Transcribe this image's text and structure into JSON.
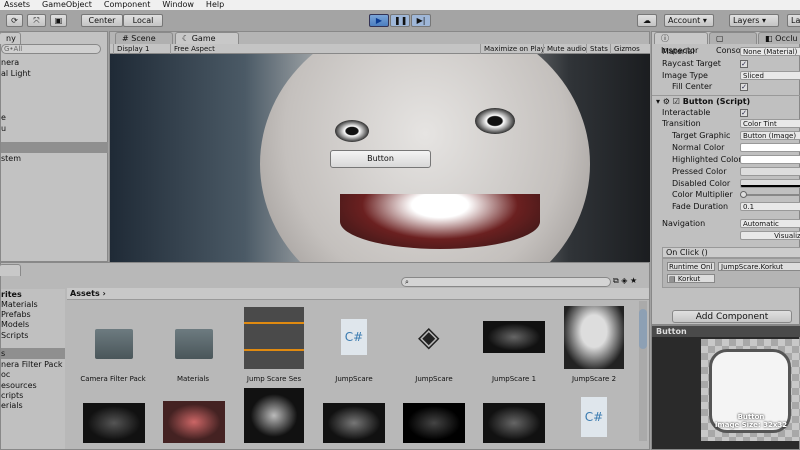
{
  "menu": [
    "Assets",
    "GameObject",
    "Component",
    "Window",
    "Help"
  ],
  "toolbar": {
    "center": "Center",
    "local": "Local",
    "account": "Account",
    "layers": "Layers",
    "layout": "La"
  },
  "hierarchy": {
    "tab": "ny",
    "search": "G•All",
    "items": [
      "nera",
      "al Light",
      "",
      "e",
      "u",
      "",
      "stem"
    ]
  },
  "scene": {
    "tab_scene": "Scene",
    "tab_game": "Game",
    "display": "Display 1",
    "aspect": "Free Aspect",
    "maximize": "Maximize on Play",
    "mute": "Mute audio",
    "stats": "Stats",
    "gizmos": "Gizmos",
    "game_button": "Button"
  },
  "project": {
    "favorites": "rites",
    "fav_items": [
      "Materials",
      "Prefabs",
      "Models",
      "Scripts"
    ],
    "assets_root": "s",
    "asset_items": [
      "nera Filter Pack",
      "oc",
      "esources",
      "cripts",
      "erials"
    ],
    "breadcrumb": "Assets",
    "assets": [
      "Camera Filter Pack",
      "Materials",
      "Jump Scare Ses",
      "JumpScare",
      "JumpScare",
      "JumpScare 1",
      "JumpScare 2"
    ]
  },
  "inspector": {
    "tab_inspector": "Inspector",
    "tab_console": "Console",
    "tab_occlusion": "Occlu",
    "material_label": "Material",
    "material_value": "None (Material)",
    "raycast_label": "Raycast Target",
    "image_type_label": "Image Type",
    "image_type_value": "Sliced",
    "fill_center_label": "Fill Center",
    "component_title": "Button (Script)",
    "interactable_label": "Interactable",
    "transition_label": "Transition",
    "transition_value": "Color Tint",
    "target_graphic_label": "Target Graphic",
    "target_graphic_value": "Button (Image)",
    "normal_color_label": "Normal Color",
    "highlighted_color_label": "Highlighted Color",
    "pressed_color_label": "Pressed Color",
    "disabled_color_label": "Disabled Color",
    "color_multiplier_label": "Color Multiplier",
    "fade_label": "Fade Duration",
    "fade_value": "0.1",
    "navigation_label": "Navigation",
    "navigation_value": "Automatic",
    "visualize": "Visualize",
    "onclick": "On Click ()",
    "runtime": "Runtime Onl",
    "function": "JumpScare.Korkut",
    "object": "Korkut",
    "add_component": "Add Component"
  },
  "preview": {
    "title": "Button",
    "name": "Button",
    "size": "Image Size: 32x32"
  }
}
